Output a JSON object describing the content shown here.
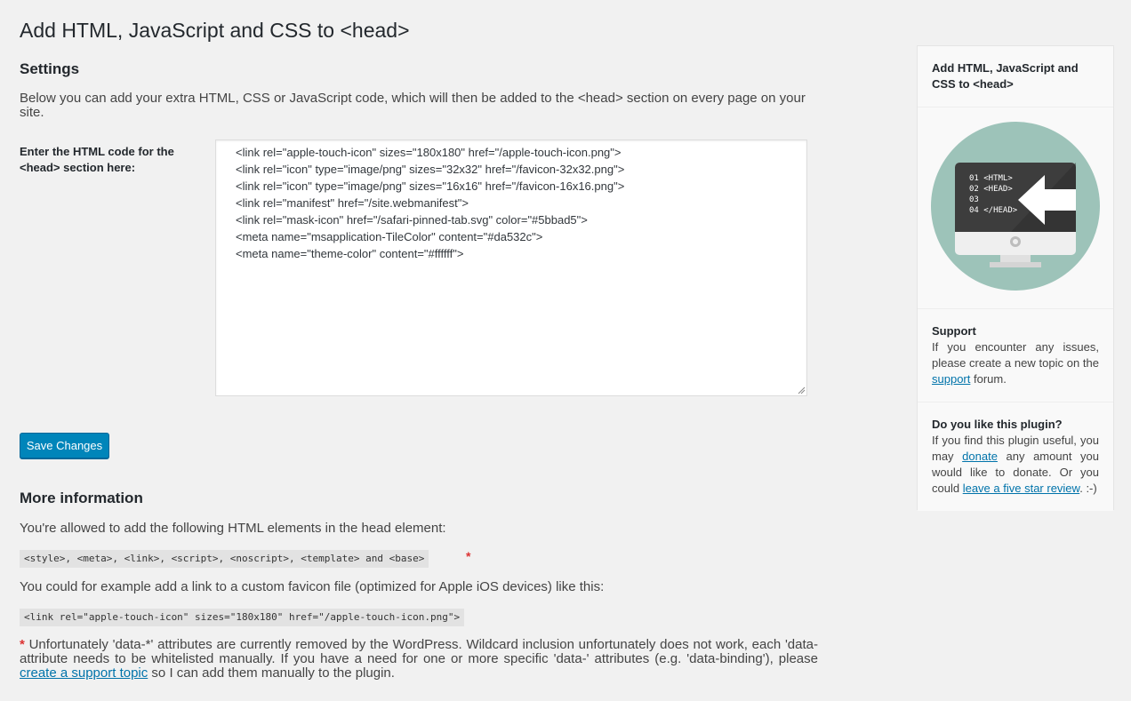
{
  "page": {
    "title": "Add HTML, JavaScript and CSS to <head>"
  },
  "settings": {
    "heading": "Settings",
    "intro": "Below you can add your extra HTML, CSS or JavaScript code, which will then be added to the <head> section on every page on your site.",
    "field_label": "Enter the HTML code for the <head> section here:",
    "code_lines": [
      "<link rel=\"apple-touch-icon\" sizes=\"180x180\" href=\"/apple-touch-icon.png\">",
      "<link rel=\"icon\" type=\"image/png\" sizes=\"32x32\" href=\"/favicon-32x32.png\">",
      "<link rel=\"icon\" type=\"image/png\" sizes=\"16x16\" href=\"/favicon-16x16.png\">",
      "<link rel=\"manifest\" href=\"/site.webmanifest\">",
      "<link rel=\"mask-icon\" href=\"/safari-pinned-tab.svg\" color=\"#5bbad5\">",
      "<meta name=\"msapplication-TileColor\" content=\"#da532c\">",
      "<meta name=\"theme-color\" content=\"#ffffff\">"
    ],
    "save_label": "Save Changes"
  },
  "more_info": {
    "heading": "More information",
    "allowed_text": "You're allowed to add the following HTML elements in the head element:",
    "allowed_elements": "<style>, <meta>, <link>, <script>, <noscript>, <template> and <base>",
    "asterisk": "*",
    "example_text": "You could for example add a link to a custom favicon file (optimized for Apple iOS devices) like this:",
    "example_code": "<link rel=\"apple-touch-icon\" sizes=\"180x180\" href=\"/apple-touch-icon.png\">",
    "note_asterisk": "*",
    "note_text": " Unfortunately 'data-*' attributes are currently removed by the WordPress. Wildcard inclusion unfortunately does not work, each 'data- attribute needs to be whitelisted manually. If you have a need for one or more specific 'data-' attributes (e.g. 'data-binding'), please ",
    "note_link": "create a support topic",
    "note_tail": " so I can add them manually to the plugin."
  },
  "sidebar": {
    "title": "Add HTML, JavaScript and CSS to <head>",
    "illustration": {
      "code_lines": [
        "01 <HTML>",
        "02 <HEAD>",
        "03",
        "04 </HEAD>"
      ],
      "circle_color": "#9dc3b9",
      "screen_color": "#3d3d3d"
    },
    "support": {
      "heading": "Support",
      "text_before": "If you encounter any issues, please create a new topic on the ",
      "link": "support",
      "text_after": " forum."
    },
    "like": {
      "heading": "Do you like this plugin?",
      "text_1": "If you find this plugin useful, you may ",
      "donate_link": "donate",
      "text_2": " any amount you would like to donate. Or you could ",
      "review_link": "leave a five star review",
      "text_3": ". :-)"
    }
  }
}
